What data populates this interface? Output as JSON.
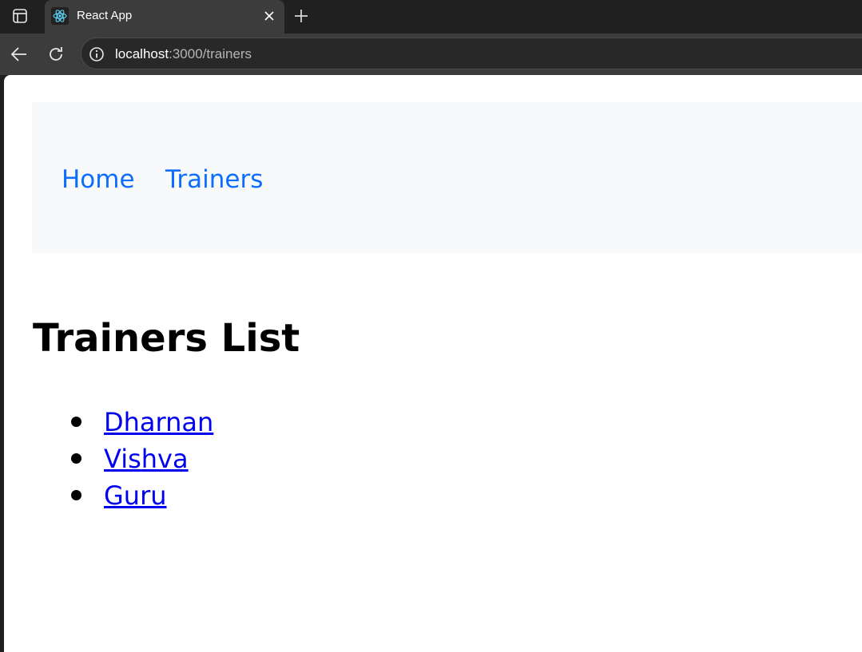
{
  "browser": {
    "tab": {
      "title": "React App",
      "favicon": "react-logo-icon"
    },
    "address": {
      "host": "localhost",
      "path": ":3000/trainers"
    },
    "icons": {
      "tab_actions": "tab-actions-icon",
      "close": "close-icon",
      "new_tab": "plus-icon",
      "back": "back-arrow-icon",
      "reload": "reload-icon",
      "site_info": "info-icon"
    }
  },
  "navbar": {
    "links": [
      {
        "label": "Home"
      },
      {
        "label": "Trainers"
      }
    ],
    "link_color": "#0d6efd",
    "background": "#f8f9fa"
  },
  "main": {
    "heading": "Trainers List",
    "trainers": [
      {
        "name": "Dharnan"
      },
      {
        "name": "Vishva"
      },
      {
        "name": "Guru"
      }
    ],
    "link_color": "#0000ee"
  }
}
